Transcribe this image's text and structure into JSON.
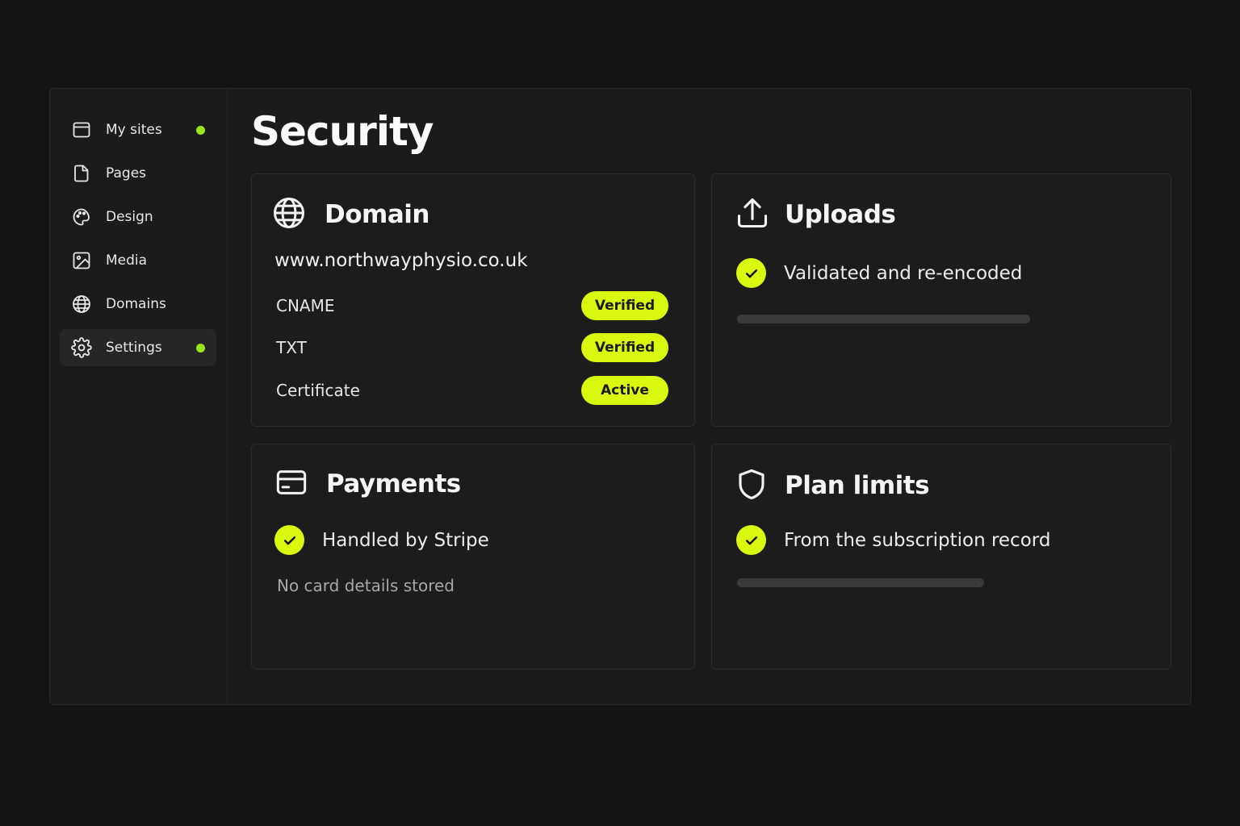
{
  "colors": {
    "accent": "#d8f90f",
    "dot": "#9be51c"
  },
  "sidebar": {
    "items": [
      {
        "label": "My sites",
        "icon": "browser-window-icon",
        "dot": true
      },
      {
        "label": "Pages",
        "icon": "document-icon",
        "dot": false
      },
      {
        "label": "Design",
        "icon": "palette-icon",
        "dot": false
      },
      {
        "label": "Media",
        "icon": "image-icon",
        "dot": false
      },
      {
        "label": "Domains",
        "icon": "globe-icon",
        "dot": false
      },
      {
        "label": "Settings",
        "icon": "gear-icon",
        "dot": true,
        "active": true
      }
    ]
  },
  "main": {
    "title": "Security",
    "domain_card": {
      "title": "Domain",
      "icon": "globe-icon",
      "url": "www.northwayphysio.co.uk",
      "rows": [
        {
          "label": "CNAME",
          "status": "Verified"
        },
        {
          "label": "TXT",
          "status": "Verified"
        },
        {
          "label": "Certificate",
          "status": "Active"
        }
      ]
    },
    "uploads_card": {
      "title": "Uploads",
      "icon": "upload-icon",
      "check_text": "Validated and re-encoded"
    },
    "payments_card": {
      "title": "Payments",
      "icon": "credit-card-icon",
      "check_text": "Handled by Stripe",
      "note": "No card details stored"
    },
    "plan_card": {
      "title": "Plan limits",
      "icon": "shield-icon",
      "check_text": "From the subscription record"
    }
  }
}
